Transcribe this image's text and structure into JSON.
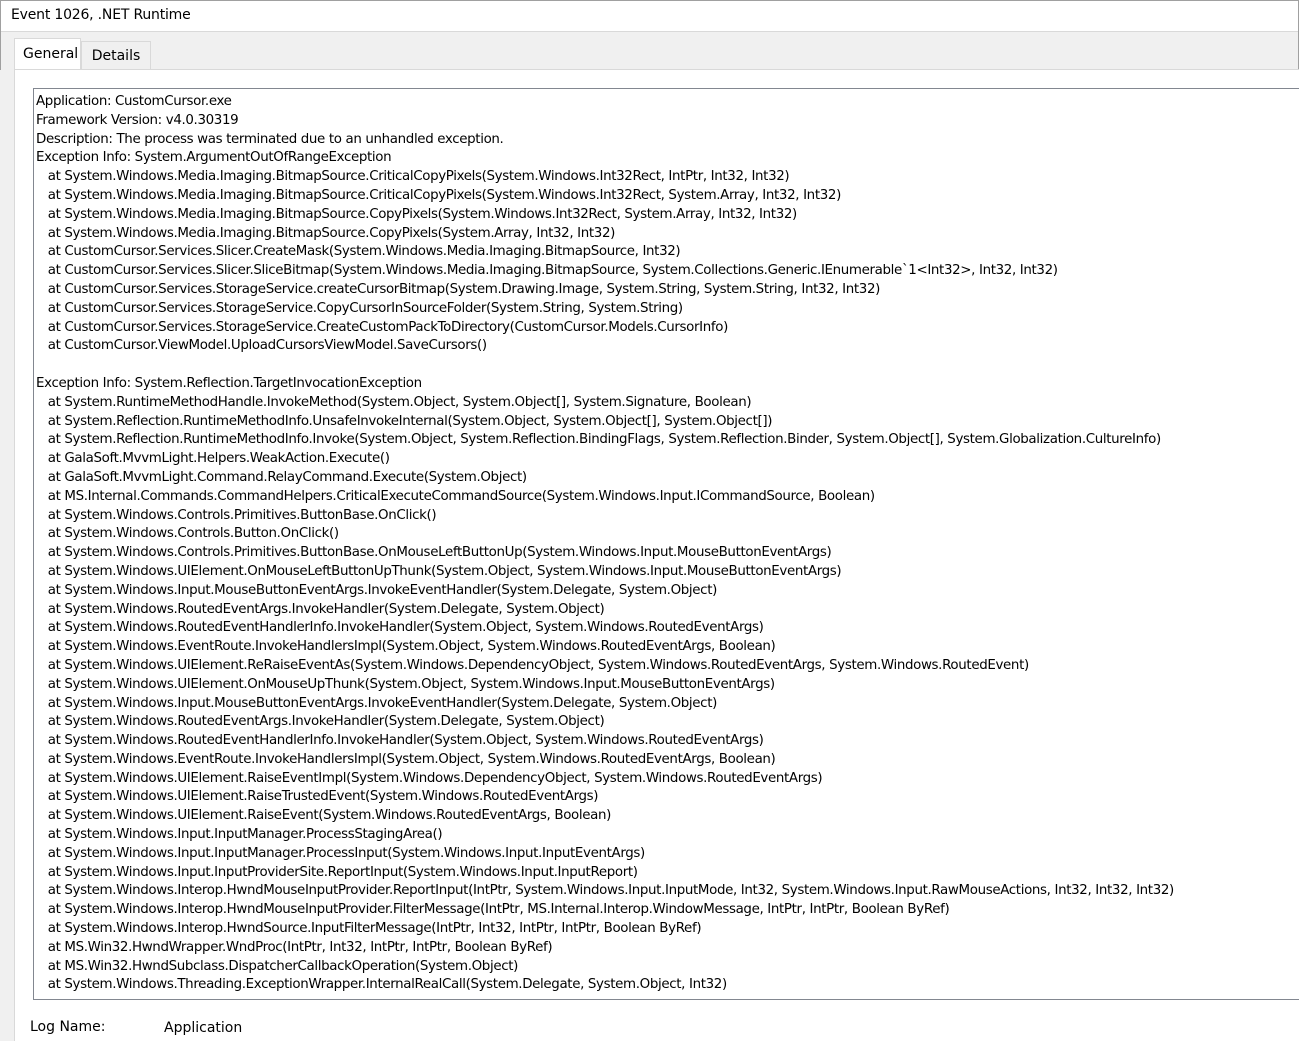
{
  "window": {
    "title": "Event 1026, .NET Runtime"
  },
  "tabs": [
    {
      "label": "General",
      "active": true
    },
    {
      "label": "Details",
      "active": false
    }
  ],
  "description": {
    "lines": [
      "Application: CustomCursor.exe",
      "Framework Version: v4.0.30319",
      "Description: The process was terminated due to an unhandled exception.",
      "Exception Info: System.ArgumentOutOfRangeException",
      "   at System.Windows.Media.Imaging.BitmapSource.CriticalCopyPixels(System.Windows.Int32Rect, IntPtr, Int32, Int32)",
      "   at System.Windows.Media.Imaging.BitmapSource.CriticalCopyPixels(System.Windows.Int32Rect, System.Array, Int32, Int32)",
      "   at System.Windows.Media.Imaging.BitmapSource.CopyPixels(System.Windows.Int32Rect, System.Array, Int32, Int32)",
      "   at System.Windows.Media.Imaging.BitmapSource.CopyPixels(System.Array, Int32, Int32)",
      "   at CustomCursor.Services.Slicer.CreateMask(System.Windows.Media.Imaging.BitmapSource, Int32)",
      "   at CustomCursor.Services.Slicer.SliceBitmap(System.Windows.Media.Imaging.BitmapSource, System.Collections.Generic.IEnumerable`1<Int32>, Int32, Int32)",
      "   at CustomCursor.Services.StorageService.createCursorBitmap(System.Drawing.Image, System.String, System.String, Int32, Int32)",
      "   at CustomCursor.Services.StorageService.CopyCursorInSourceFolder(System.String, System.String)",
      "   at CustomCursor.Services.StorageService.CreateCustomPackToDirectory(CustomCursor.Models.CursorInfo)",
      "   at CustomCursor.ViewModel.UploadCursorsViewModel.SaveCursors()",
      "",
      "Exception Info: System.Reflection.TargetInvocationException",
      "   at System.RuntimeMethodHandle.InvokeMethod(System.Object, System.Object[], System.Signature, Boolean)",
      "   at System.Reflection.RuntimeMethodInfo.UnsafeInvokeInternal(System.Object, System.Object[], System.Object[])",
      "   at System.Reflection.RuntimeMethodInfo.Invoke(System.Object, System.Reflection.BindingFlags, System.Reflection.Binder, System.Object[], System.Globalization.CultureInfo)",
      "   at GalaSoft.MvvmLight.Helpers.WeakAction.Execute()",
      "   at GalaSoft.MvvmLight.Command.RelayCommand.Execute(System.Object)",
      "   at MS.Internal.Commands.CommandHelpers.CriticalExecuteCommandSource(System.Windows.Input.ICommandSource, Boolean)",
      "   at System.Windows.Controls.Primitives.ButtonBase.OnClick()",
      "   at System.Windows.Controls.Button.OnClick()",
      "   at System.Windows.Controls.Primitives.ButtonBase.OnMouseLeftButtonUp(System.Windows.Input.MouseButtonEventArgs)",
      "   at System.Windows.UIElement.OnMouseLeftButtonUpThunk(System.Object, System.Windows.Input.MouseButtonEventArgs)",
      "   at System.Windows.Input.MouseButtonEventArgs.InvokeEventHandler(System.Delegate, System.Object)",
      "   at System.Windows.RoutedEventArgs.InvokeHandler(System.Delegate, System.Object)",
      "   at System.Windows.RoutedEventHandlerInfo.InvokeHandler(System.Object, System.Windows.RoutedEventArgs)",
      "   at System.Windows.EventRoute.InvokeHandlersImpl(System.Object, System.Windows.RoutedEventArgs, Boolean)",
      "   at System.Windows.UIElement.ReRaiseEventAs(System.Windows.DependencyObject, System.Windows.RoutedEventArgs, System.Windows.RoutedEvent)",
      "   at System.Windows.UIElement.OnMouseUpThunk(System.Object, System.Windows.Input.MouseButtonEventArgs)",
      "   at System.Windows.Input.MouseButtonEventArgs.InvokeEventHandler(System.Delegate, System.Object)",
      "   at System.Windows.RoutedEventArgs.InvokeHandler(System.Delegate, System.Object)",
      "   at System.Windows.RoutedEventHandlerInfo.InvokeHandler(System.Object, System.Windows.RoutedEventArgs)",
      "   at System.Windows.EventRoute.InvokeHandlersImpl(System.Object, System.Windows.RoutedEventArgs, Boolean)",
      "   at System.Windows.UIElement.RaiseEventImpl(System.Windows.DependencyObject, System.Windows.RoutedEventArgs)",
      "   at System.Windows.UIElement.RaiseTrustedEvent(System.Windows.RoutedEventArgs)",
      "   at System.Windows.UIElement.RaiseEvent(System.Windows.RoutedEventArgs, Boolean)",
      "   at System.Windows.Input.InputManager.ProcessStagingArea()",
      "   at System.Windows.Input.InputManager.ProcessInput(System.Windows.Input.InputEventArgs)",
      "   at System.Windows.Input.InputProviderSite.ReportInput(System.Windows.Input.InputReport)",
      "   at System.Windows.Interop.HwndMouseInputProvider.ReportInput(IntPtr, System.Windows.Input.InputMode, Int32, System.Windows.Input.RawMouseActions, Int32, Int32, Int32)",
      "   at System.Windows.Interop.HwndMouseInputProvider.FilterMessage(IntPtr, MS.Internal.Interop.WindowMessage, IntPtr, IntPtr, Boolean ByRef)",
      "   at System.Windows.Interop.HwndSource.InputFilterMessage(IntPtr, Int32, IntPtr, IntPtr, Boolean ByRef)",
      "   at MS.Win32.HwndWrapper.WndProc(IntPtr, Int32, IntPtr, IntPtr, Boolean ByRef)",
      "   at MS.Win32.HwndSubclass.DispatcherCallbackOperation(System.Object)",
      "   at System.Windows.Threading.ExceptionWrapper.InternalRealCall(System.Delegate, System.Object, Int32)"
    ]
  },
  "fields": {
    "log_name_label": "Log Name:",
    "log_name_value": "Application"
  }
}
